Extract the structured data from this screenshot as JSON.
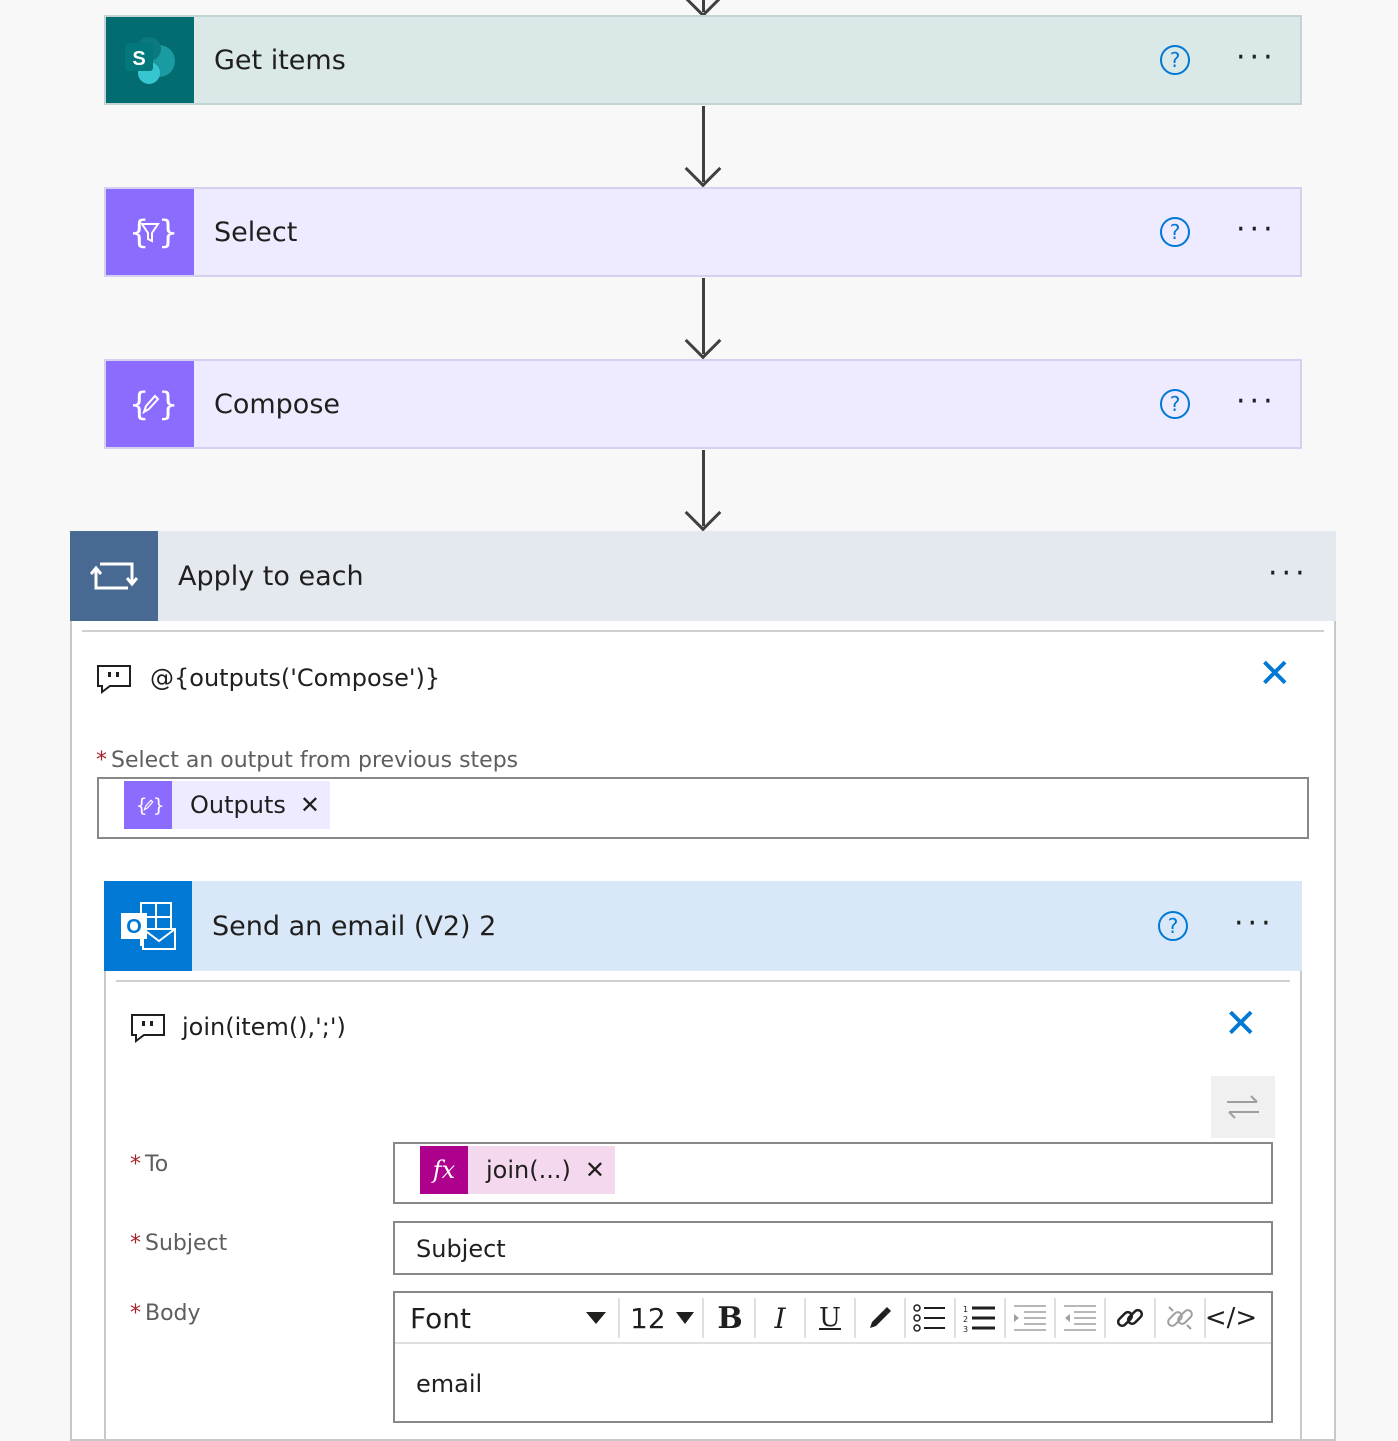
{
  "steps": [
    {
      "title": "Get items",
      "icon": "sharepoint-icon",
      "icon_letter": "S",
      "bg": "#dae8e8",
      "icon_bg": "#036c70"
    },
    {
      "title": "Select",
      "icon": "select-icon",
      "bg": "#eeeaff",
      "icon_bg": "#8c6cff"
    },
    {
      "title": "Compose",
      "icon": "compose-icon",
      "bg": "#eeeaff",
      "icon_bg": "#8c6cff"
    }
  ],
  "help_symbol": "?",
  "more_symbol": "···",
  "apply_each": {
    "title": "Apply to each",
    "comment": "@{outputs('Compose')}",
    "close_symbol": "✕",
    "output_label": "Select an output from previous steps",
    "output_token": "Outputs",
    "token_remove": "✕"
  },
  "send_email": {
    "title": "Send an email (V2) 2",
    "comment": "join(item(),';')",
    "fields": {
      "to_label": "To",
      "to_token": "join(...)",
      "subject_label": "Subject",
      "subject_value": "Subject",
      "body_label": "Body",
      "body_value": "email"
    },
    "toolbar": {
      "font": "Font",
      "size": "12",
      "bold": "B",
      "italic": "I",
      "underline": "U",
      "code": "</>"
    }
  },
  "required_mark": "*",
  "colors": {
    "sharepoint": "#036c70",
    "data_ops": "#8c6cff",
    "loop": "#486991",
    "outlook": "#0078d4",
    "expression": "#ad008c",
    "link_blue": "#0078d4"
  }
}
